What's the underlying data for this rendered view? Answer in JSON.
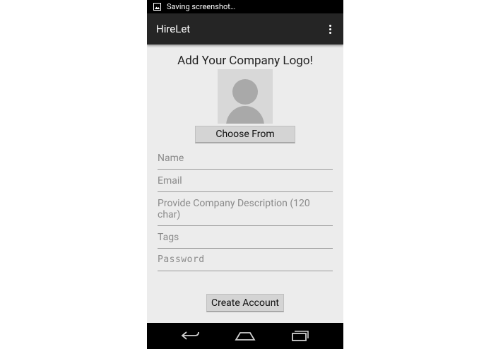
{
  "status_bar": {
    "notification_text": "Saving screenshot…"
  },
  "app": {
    "title": "HireLet"
  },
  "form": {
    "heading": "Add Your Company Logo!",
    "choose_label": "Choose From",
    "fields": {
      "name": "Name",
      "email": "Email",
      "description": "Provide Company Description (120 char)",
      "tags": "Tags",
      "password": "Password"
    },
    "submit_label": "Create Account"
  },
  "colors": {
    "action_bar": "#252525",
    "background": "#ececec",
    "button": "#d4d4d4"
  },
  "icons": [
    "image-icon",
    "overflow-menu-icon",
    "avatar-placeholder-icon",
    "back-icon",
    "home-icon",
    "recents-icon"
  ]
}
